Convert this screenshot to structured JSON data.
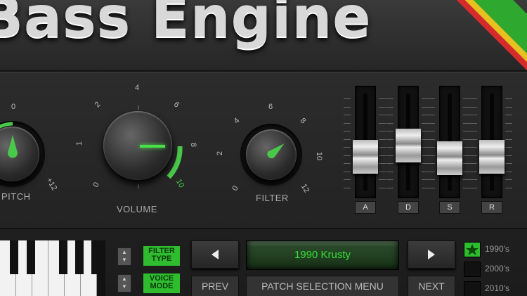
{
  "header": {
    "title": "Bass Engine"
  },
  "knobs": {
    "pitch": {
      "label": "PITCH",
      "ticks": [
        "0",
        "+12"
      ]
    },
    "volume": {
      "label": "VOLUME",
      "ticks": [
        "0",
        "1",
        "2",
        "4",
        "6",
        "8",
        "10"
      ]
    },
    "filter": {
      "label": "FILTER",
      "ticks": [
        "0",
        "2",
        "4",
        "6",
        "8",
        "10",
        "12"
      ]
    }
  },
  "envelope": {
    "sliders": [
      {
        "label": "A",
        "level": 0.3
      },
      {
        "label": "D",
        "level": 0.45
      },
      {
        "label": "S",
        "level": 0.28
      },
      {
        "label": "R",
        "level": 0.3
      }
    ]
  },
  "controls": {
    "filter_type": "FILTER TYPE",
    "voice_mode": "VOICE MODE",
    "prev_label": "PREV",
    "next_label": "NEXT",
    "menu_label": "PATCH SELECTION MENU",
    "patch_name": "1990 Krusty"
  },
  "eras": [
    {
      "label": "1990's",
      "active": true
    },
    {
      "label": "2000's",
      "active": false
    },
    {
      "label": "2010's",
      "active": false
    }
  ],
  "colors": {
    "accent": "#2fbd2f",
    "stripe_red": "#d42b2b",
    "stripe_yellow": "#e8c020",
    "stripe_green": "#2fa82f"
  }
}
